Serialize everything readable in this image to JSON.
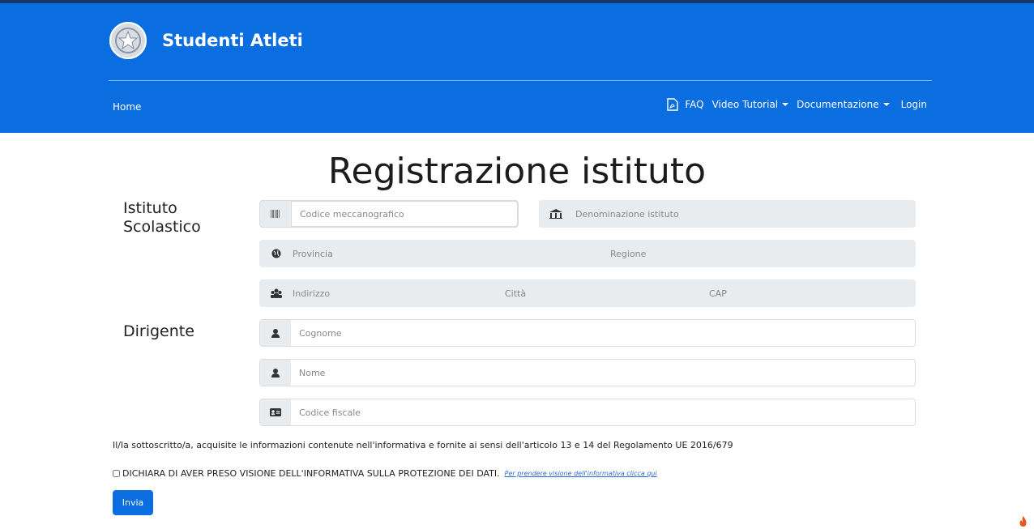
{
  "header": {
    "brand_title": "Studenti Atleti",
    "nav_home": "Home",
    "nav_faq": "FAQ",
    "nav_video": "Video Tutorial",
    "nav_docs": "Documentazione",
    "nav_login": "Login",
    "background_color": "#0a6ee0"
  },
  "main": {
    "page_title": "Registrazione istituto",
    "section_istituto_label": "Istituto Scolastico",
    "section_dirigente_label": "Dirigente",
    "fields": {
      "codice_placeholder": "Codice meccanografico",
      "denominazione_placeholder": "Denominazione istituto",
      "provincia_placeholder": "Provincia",
      "regione_placeholder": "Regione",
      "indirizzo_placeholder": "Indirizzo",
      "citta_placeholder": "Città",
      "cap_placeholder": "CAP",
      "cognome_placeholder": "Cognome",
      "nome_placeholder": "Nome",
      "codice_fiscale_placeholder": "Codice fiscale"
    },
    "info_text": "Il/la sottoscritto/a, acquisite le informazioni contenute nell'informativa e fornite ai sensi dell'articolo 13 e 14 del Regolamento UE 2016/679",
    "declaration_text": "DICHIARA DI AVER PRESO VISIONE DELL'INFORMATIVA SULLA PROTEZIONE DEI DATI.",
    "declaration_link": "Per prendere visione dell'informativa clicca qui",
    "submit_label": "Invia"
  }
}
